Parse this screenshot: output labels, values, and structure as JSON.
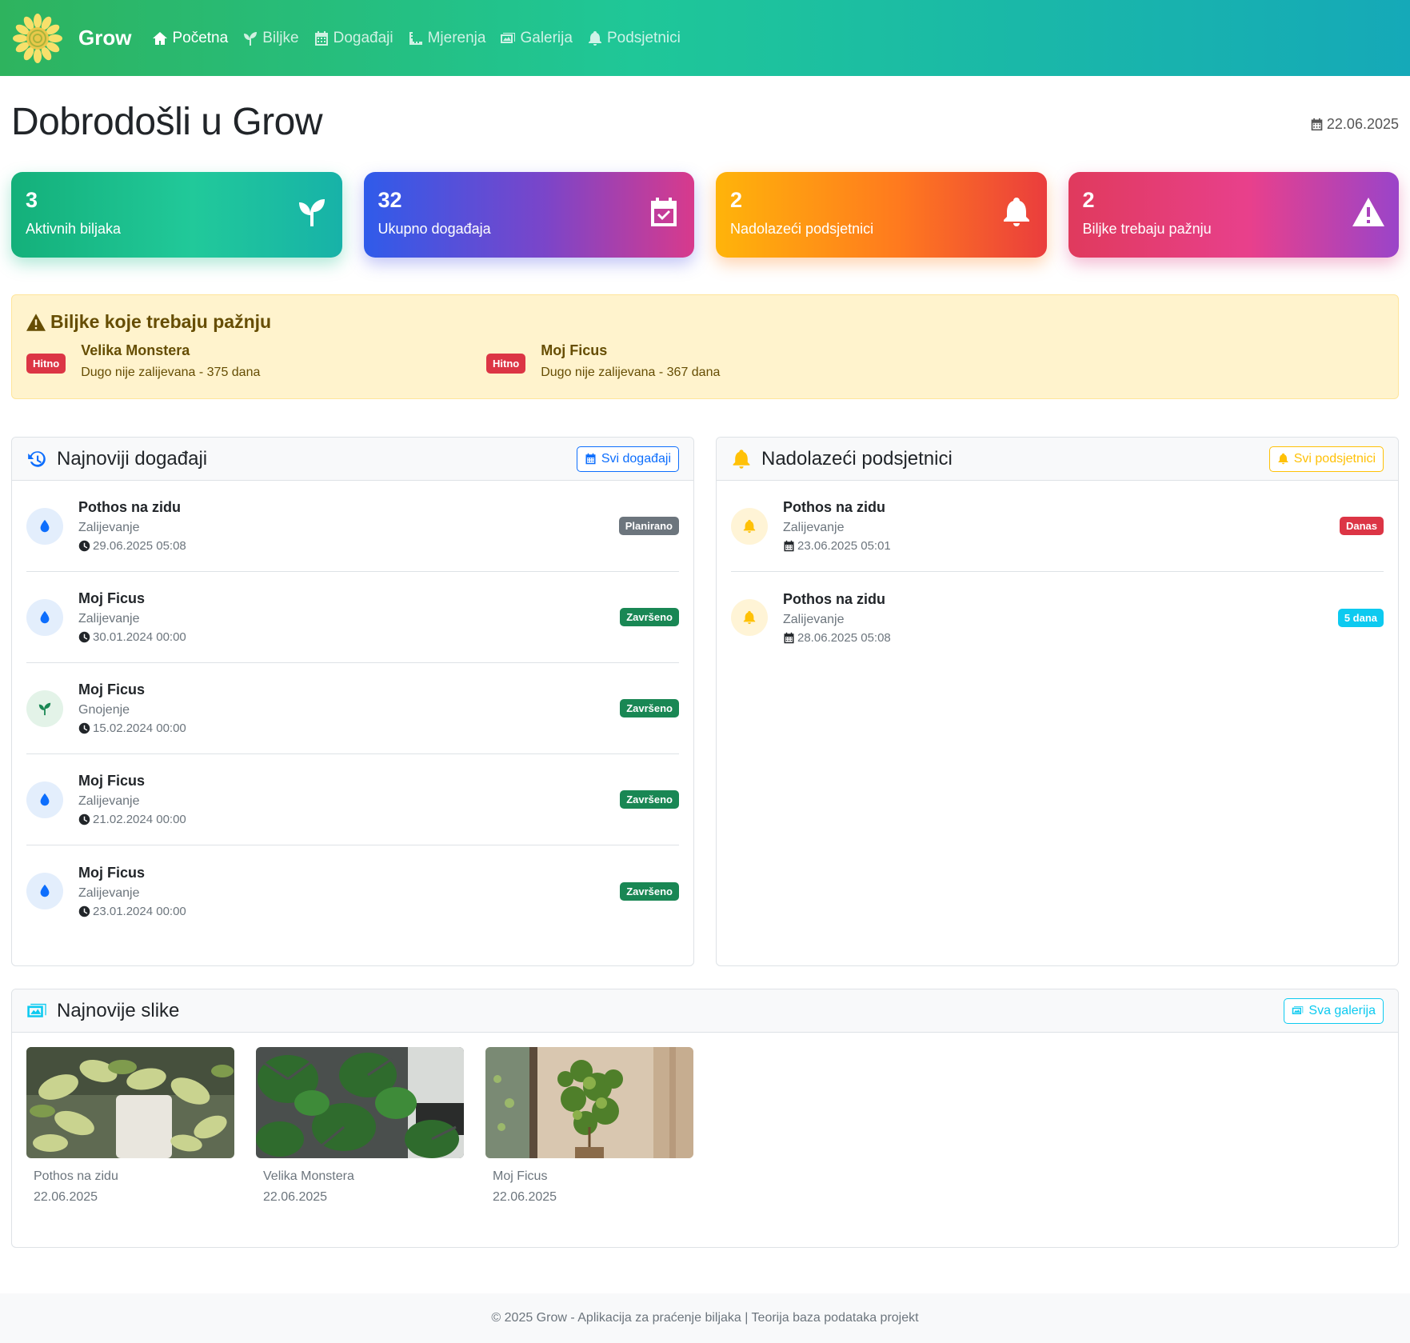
{
  "nav": {
    "brand": "Grow",
    "items": [
      {
        "label": "Početna",
        "icon": "home-icon",
        "active": true
      },
      {
        "label": "Biljke",
        "icon": "seedling-icon",
        "active": false
      },
      {
        "label": "Događaji",
        "icon": "calendar-icon",
        "active": false
      },
      {
        "label": "Mjerenja",
        "icon": "ruler-icon",
        "active": false
      },
      {
        "label": "Galerija",
        "icon": "images-icon",
        "active": false
      },
      {
        "label": "Podsjetnici",
        "icon": "bell-icon",
        "active": false
      }
    ]
  },
  "header": {
    "title": "Dobrodošli u Grow",
    "date": "22.06.2025"
  },
  "stats": [
    {
      "value": "3",
      "label": "Aktivnih biljaka",
      "icon": "seedling-icon"
    },
    {
      "value": "32",
      "label": "Ukupno događaja",
      "icon": "calendar-check-icon"
    },
    {
      "value": "2",
      "label": "Nadolazeći podsjetnici",
      "icon": "bell-icon"
    },
    {
      "value": "2",
      "label": "Biljke trebaju pažnju",
      "icon": "warning-icon"
    }
  ],
  "attention": {
    "title": "Biljke koje trebaju pažnju",
    "items": [
      {
        "badge": "Hitno",
        "name": "Velika Monstera",
        "desc": "Dugo nije zalijevana - 375 dana"
      },
      {
        "badge": "Hitno",
        "name": "Moj Ficus",
        "desc": "Dugo nije zalijevana - 367 dana"
      }
    ]
  },
  "events": {
    "title": "Najnoviji događaji",
    "button": "Svi događaji",
    "items": [
      {
        "name": "Pothos na zidu",
        "type": "Zalijevanje",
        "time": "29.06.2025 05:08",
        "status": "Planirano",
        "icon": "water-drop-icon"
      },
      {
        "name": "Moj Ficus",
        "type": "Zalijevanje",
        "time": "30.01.2024 00:00",
        "status": "Završeno",
        "icon": "water-drop-icon"
      },
      {
        "name": "Moj Ficus",
        "type": "Gnojenje",
        "time": "15.02.2024 00:00",
        "status": "Završeno",
        "icon": "seedling-icon"
      },
      {
        "name": "Moj Ficus",
        "type": "Zalijevanje",
        "time": "21.02.2024 00:00",
        "status": "Završeno",
        "icon": "water-drop-icon"
      },
      {
        "name": "Moj Ficus",
        "type": "Zalijevanje",
        "time": "23.01.2024 00:00",
        "status": "Završeno",
        "icon": "water-drop-icon"
      }
    ]
  },
  "reminders": {
    "title": "Nadolazeći podsjetnici",
    "button": "Svi podsjetnici",
    "items": [
      {
        "name": "Pothos na zidu",
        "type": "Zalijevanje",
        "time": "23.06.2025 05:01",
        "badge": "Danas"
      },
      {
        "name": "Pothos na zidu",
        "type": "Zalijevanje",
        "time": "28.06.2025 05:08",
        "badge": "5 dana"
      }
    ]
  },
  "gallery": {
    "title": "Najnovije slike",
    "button": "Sva galerija",
    "items": [
      {
        "name": "Pothos na zidu",
        "date": "22.06.2025"
      },
      {
        "name": "Velika Monstera",
        "date": "22.06.2025"
      },
      {
        "name": "Moj Ficus",
        "date": "22.06.2025"
      }
    ]
  },
  "footer": "© 2025 Grow - Aplikacija za praćenje biljaka | Teorija baza podataka projekt",
  "colors": {
    "primary": "#0d6efd",
    "success": "#198754",
    "danger": "#dc3545",
    "warning": "#ffc107",
    "info": "#0dcaf0",
    "secondary": "#6c757d"
  }
}
